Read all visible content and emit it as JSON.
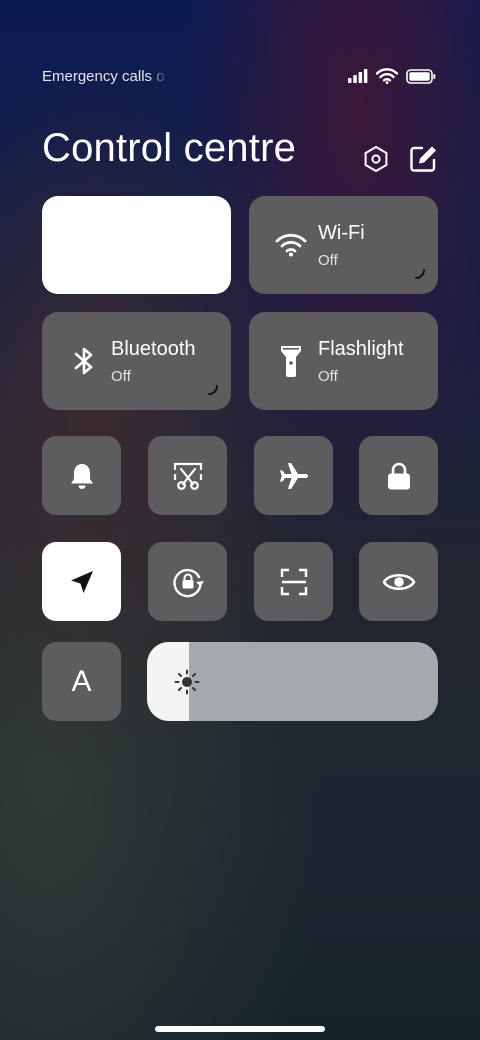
{
  "status": {
    "carrier_text": "Emergency calls o",
    "icons": [
      "signal-icon",
      "wifi-icon",
      "battery-icon"
    ]
  },
  "header": {
    "title": "Control centre",
    "icons": [
      "settings-icon",
      "edit-icon"
    ]
  },
  "tiles": {
    "media": {
      "active": true
    },
    "wifi": {
      "label": "Wi-Fi",
      "state": "Off",
      "icon": "wifi-icon"
    },
    "bluetooth": {
      "label": "Bluetooth",
      "state": "Off",
      "icon": "bluetooth-icon"
    },
    "flashlight": {
      "label": "Flashlight",
      "state": "Off",
      "icon": "flashlight-icon"
    }
  },
  "toggles": [
    {
      "name": "sound",
      "icon": "bell-icon",
      "active": false
    },
    {
      "name": "screenshot",
      "icon": "scissors-icon",
      "active": false
    },
    {
      "name": "airplane-mode",
      "icon": "airplane-icon",
      "active": false
    },
    {
      "name": "lock-screen",
      "icon": "lock-icon",
      "active": false
    },
    {
      "name": "location",
      "icon": "location-arrow-icon",
      "active": true
    },
    {
      "name": "rotation-lock",
      "icon": "rotation-lock-icon",
      "active": false
    },
    {
      "name": "scanner",
      "icon": "scan-icon",
      "active": false
    },
    {
      "name": "reading-mode",
      "icon": "eye-icon",
      "active": false
    },
    {
      "name": "auto-brightness",
      "icon": "auto-brightness-icon",
      "label": "A",
      "active": false
    }
  ],
  "brightness": {
    "level": 0.145,
    "icon": "sun-icon"
  },
  "colors": {
    "tile": "#5d5d5f",
    "active_tile": "#ffffff",
    "slider_track": "#a4a9ad",
    "slider_fill": "#f4f4f4"
  }
}
